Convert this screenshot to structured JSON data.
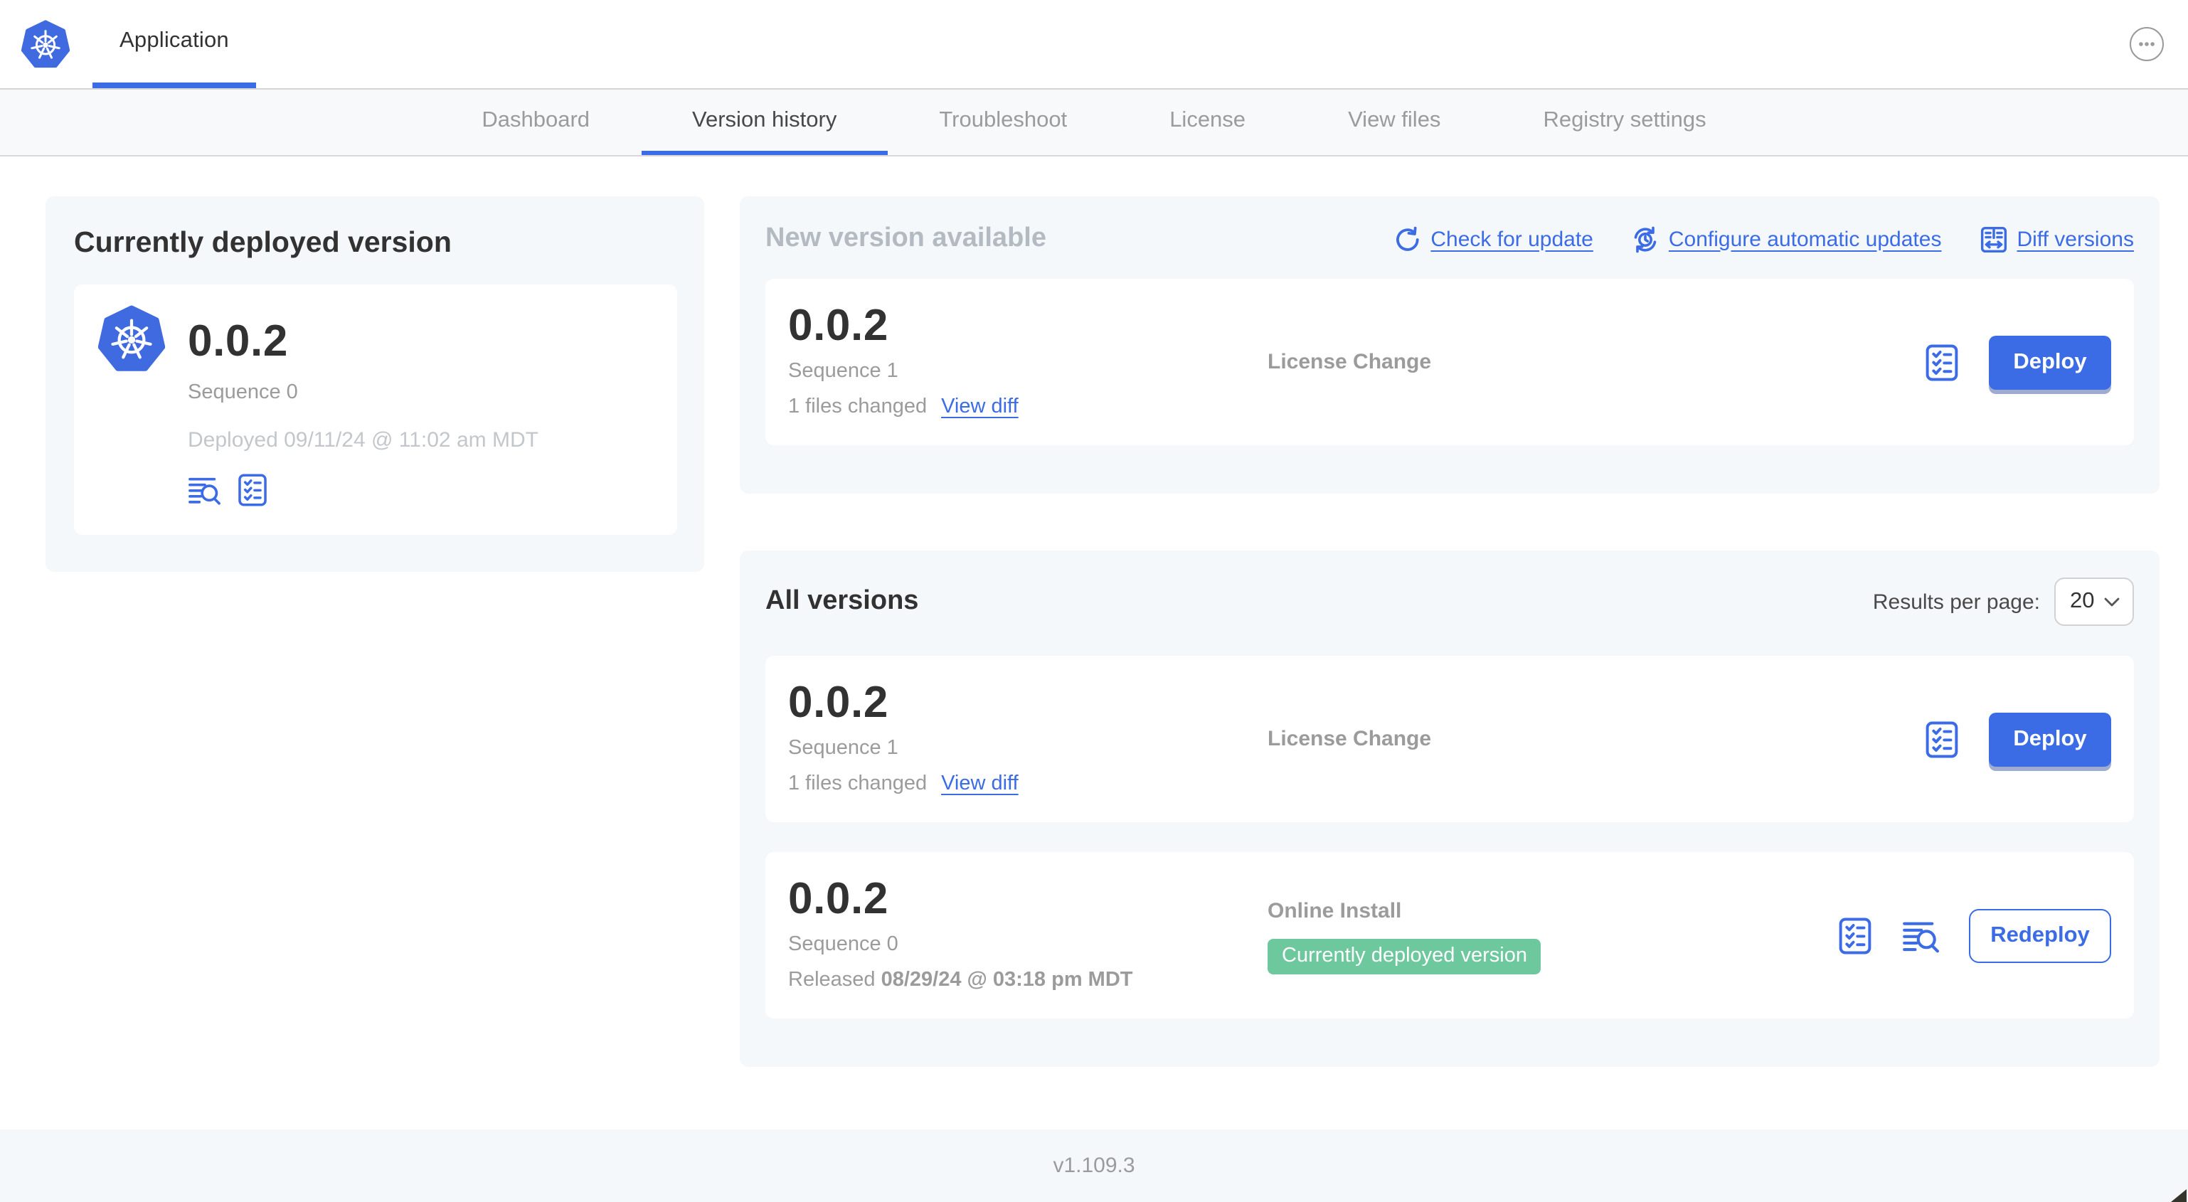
{
  "colors": {
    "accent_blue": "#3b6ce5",
    "badge_green": "#6dc99d",
    "panel_gray": "#f5f8fa"
  },
  "header": {
    "app_tab_label": "Application"
  },
  "nav": {
    "active_tab": "Version history",
    "tabs": [
      {
        "label": "Dashboard"
      },
      {
        "label": "Version history"
      },
      {
        "label": "Troubleshoot"
      },
      {
        "label": "License"
      },
      {
        "label": "View files"
      },
      {
        "label": "Registry settings"
      }
    ]
  },
  "current_version": {
    "title": "Currently deployed version",
    "version": "0.0.2",
    "sequence": "Sequence 0",
    "deployed": "Deployed 09/11/24 @ 11:02 am MDT"
  },
  "new_version": {
    "title": "New version available",
    "actions": [
      {
        "label": "Check for update",
        "icon": "refresh-icon"
      },
      {
        "label": "Configure automatic updates",
        "icon": "schedule-icon"
      },
      {
        "label": "Diff versions",
        "icon": "diff-icon"
      }
    ],
    "row": {
      "version": "0.0.2",
      "sequence": "Sequence 1",
      "files_changed": "1 files changed",
      "view_diff_label": "View diff",
      "source": "License Change",
      "deploy_label": "Deploy"
    }
  },
  "all_versions": {
    "title": "All versions",
    "results_per_page_label": "Results per page:",
    "results_per_page_value": "20",
    "rows": [
      {
        "version": "0.0.2",
        "sequence": "Sequence 1",
        "files_changed": "1 files changed",
        "view_diff_label": "View diff",
        "source": "License Change",
        "action_label": "Deploy"
      },
      {
        "version": "0.0.2",
        "sequence": "Sequence 0",
        "released_prefix": "Released ",
        "released_date": "08/29/24 @ 03:18 pm MDT",
        "source": "Online Install",
        "badge": "Currently deployed version",
        "action_label": "Redeploy"
      }
    ]
  },
  "footer": {
    "app_version": "v1.109.3"
  }
}
